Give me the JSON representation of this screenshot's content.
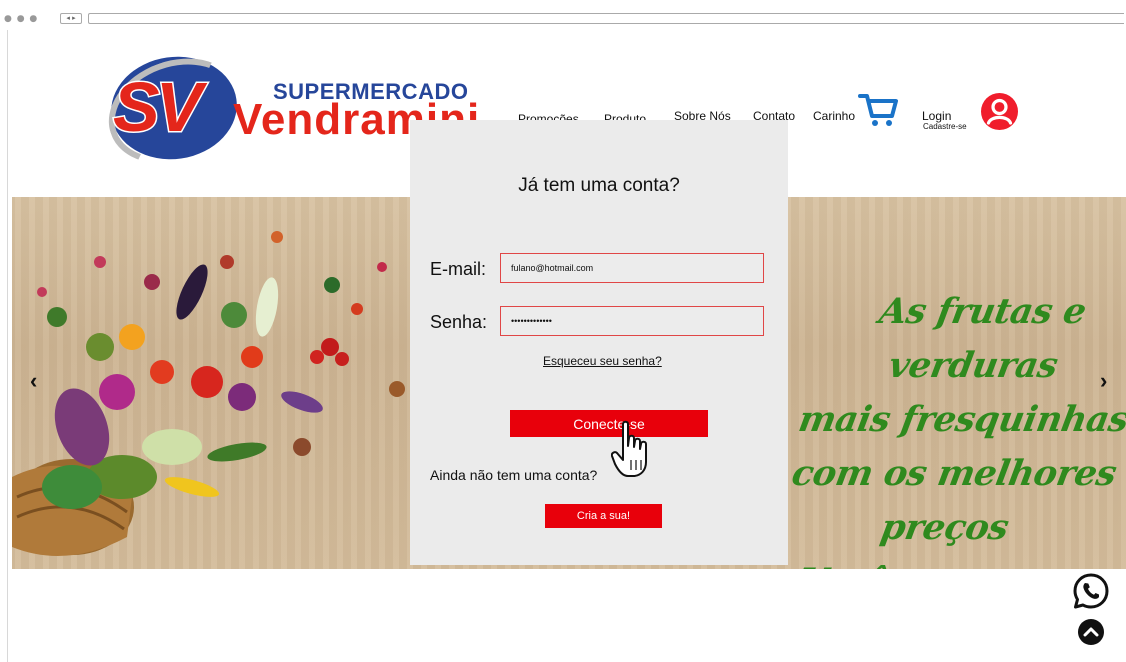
{
  "brand": {
    "logo_initials": "SV",
    "logo_top": "SUPERMERCADO",
    "logo_name": "Vendramini",
    "color_red": "#e4261b",
    "color_blue": "#26469a"
  },
  "nav": {
    "items": [
      {
        "label": "Promoções"
      },
      {
        "label": "Produto"
      },
      {
        "label": "Sobre Nós"
      },
      {
        "label": "Contato"
      },
      {
        "label": "Carinho"
      }
    ],
    "cart_icon": "shopping-cart-icon",
    "login_label": "Login",
    "signup_label": "Cadastre-se",
    "user_icon": "user-icon"
  },
  "hero": {
    "slogan_lines": [
      "As frutas e verduras",
      "mais fresquinhas",
      "com os melhores preços",
      "Você encontra Aqui!"
    ],
    "slogan_color": "#2f8a1e",
    "prev_arrow": "‹",
    "next_arrow": "›"
  },
  "login": {
    "title": "Já tem uma conta?",
    "email_label": "E-mail:",
    "email_value": "fulano@hotmail.com",
    "password_label": "Senha:",
    "password_value": "•••••••••••••",
    "forgot_link": "Esqueceu seu senha?",
    "connect_button": "Conecte-se",
    "no_account_label": "Ainda não tem uma conta?",
    "create_button": "Cria a sua!",
    "accent_color": "#e8000b"
  },
  "floating": {
    "whatsapp_icon": "whatsapp-icon",
    "scroll_top_icon": "chevron-up-icon"
  }
}
